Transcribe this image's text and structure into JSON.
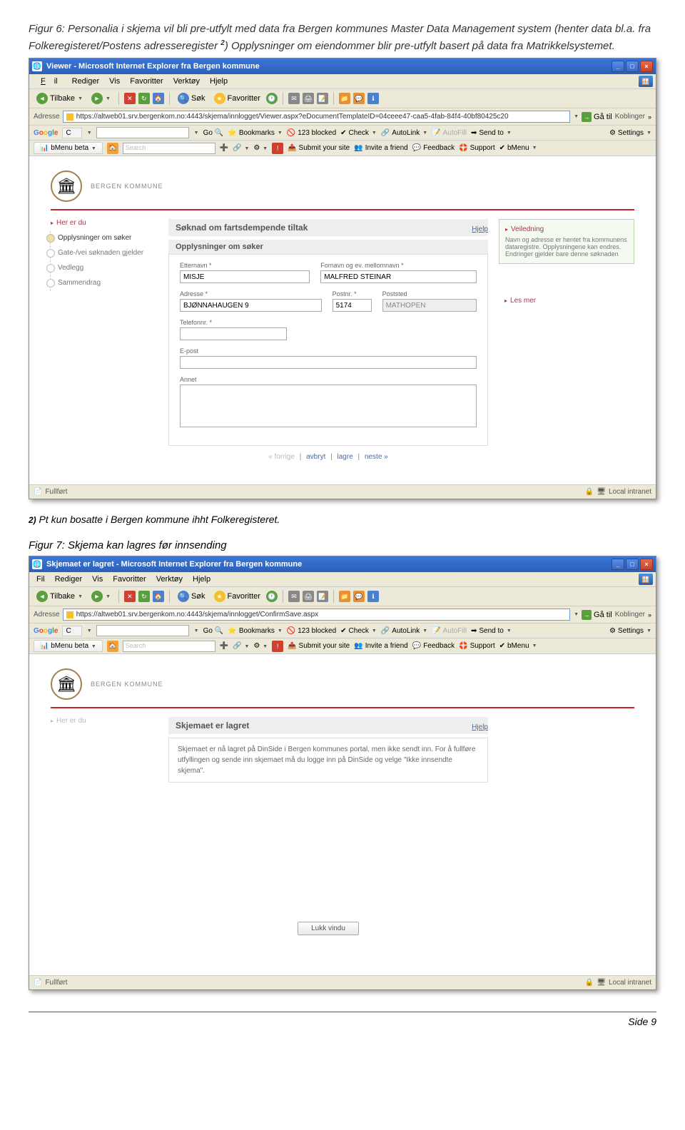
{
  "caption1": {
    "prefix": "Figur 6: Personalia i skjema vil bli pre-utfylt med data fra Bergen kommunes Master Data Management system (henter data bl.a. fra Folkeregisteret/Postens adresseregister ",
    "sup": "2",
    "suffix": ") Opplysninger om eiendommer blir pre-utfylt basert på data fra Matrikkelsystemet."
  },
  "window1": {
    "title": "Viewer - Microsoft Internet Explorer fra Bergen kommune",
    "menu": {
      "fil": "Fil",
      "rediger": "Rediger",
      "vis": "Vis",
      "favoritter": "Favoritter",
      "verktoy": "Verktøy",
      "hjelp": "Hjelp"
    },
    "toolbar": {
      "tilbake": "Tilbake",
      "sok": "Søk",
      "favoritter": "Favoritter"
    },
    "address": {
      "label": "Adresse",
      "url": "https://altweb01.srv.bergenkom.no:4443/skjema/innlogget/Viewer.aspx?eDocumentTemplateID=04ceee47-caa5-4fab-84f4-40bf80425c20",
      "ga": "Gå til",
      "koblinger": "Koblinger"
    },
    "google": {
      "cmenu": "C",
      "go": "Go",
      "bookmarks": "Bookmarks",
      "blocked": "123 blocked",
      "check": "Check",
      "autolink": "AutoLink",
      "autofill": "AutoFill",
      "sendto": "Send to",
      "settings": "Settings"
    },
    "bmenu": {
      "tab": "bMenu beta",
      "search": "Search",
      "submit": "Submit your site",
      "invite": "Invite a friend",
      "feedback": "Feedback",
      "support": "Support",
      "bmenu": "bMenu"
    }
  },
  "bergen": {
    "kommune": "BERGEN KOMMUNE"
  },
  "form1": {
    "title": "Søknad om fartsdempende tiltak",
    "hjelp": "Hjelp",
    "nav": {
      "her": "Her er du",
      "step1": "Opplysninger om søker",
      "step2": "Gate-/vei søknaden gjelder",
      "step3": "Vedlegg",
      "step4": "Sammendrag"
    },
    "subtitle": "Opplysninger om søker",
    "fields": {
      "etternavn": {
        "label": "Etternavn *",
        "value": "MISJE"
      },
      "fornavn": {
        "label": "Fornavn og ev. mellomnavn *",
        "value": "MALFRED STEINAR"
      },
      "adresse": {
        "label": "Adresse *",
        "value": "BJØNNAHAUGEN 9"
      },
      "postnr": {
        "label": "Postnr. *",
        "value": "5174"
      },
      "poststed": {
        "label": "Poststed",
        "value": "MATHOPEN"
      },
      "telefon": {
        "label": "Telefonnr. *",
        "value": ""
      },
      "epost": {
        "label": "E-post",
        "value": ""
      },
      "annet": {
        "label": "Annet",
        "value": ""
      }
    },
    "info": {
      "header": "Veiledning",
      "text": "Navn og adresse er hentet fra kommunens dataregistre. Opplysningene kan endres. Endringer gjelder bare denne søknaden",
      "lesmer": "Les mer"
    },
    "footer": {
      "forrige": "« forrige",
      "avbryt": "avbryt",
      "lagre": "lagre",
      "neste": "neste »"
    }
  },
  "statusbar": {
    "fullfort": "Fullført",
    "intranet": "Local intranet"
  },
  "footnote": {
    "sup": "2)",
    "text": " Pt kun bosatte i Bergen kommune ihht Folkeregisteret."
  },
  "caption2": "Figur 7: Skjema kan lagres før innsending",
  "window2": {
    "title": "Skjemaet er lagret - Microsoft Internet Explorer fra Bergen kommune",
    "address_url": "https://altweb01.srv.bergenkom.no:4443/skjema/innlogget/ConfirmSave.aspx"
  },
  "form2": {
    "title": "Skjemaet er lagret",
    "hjelp": "Hjelp",
    "her": "Her er du",
    "message": "Skjemaet er nå lagret på DinSide i Bergen kommunes portal, men ikke sendt inn. For å fullføre utfyllingen og sende inn skjemaet må du logge inn på DinSide og velge \"Ikke innsendte skjema\".",
    "lukk": "Lukk vindu"
  },
  "pagefooter": "Side 9"
}
